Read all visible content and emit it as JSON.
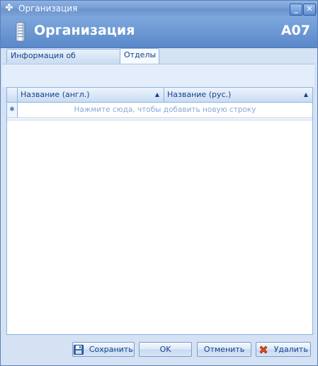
{
  "window": {
    "title": "Организация"
  },
  "header": {
    "heading": "Организация",
    "code": "A07"
  },
  "tabs": [
    {
      "label": "Информация об организации",
      "active": false
    },
    {
      "label": "Отделы",
      "active": true
    }
  ],
  "grid": {
    "columns": [
      "Название (англ.)",
      "Название (рус.)"
    ],
    "new_row_placeholder": "Нажмите сюда, чтобы добавить новую строку",
    "row_indicator": "✱"
  },
  "buttons": {
    "save": "Сохранить",
    "ok": "OK",
    "cancel": "Отменить",
    "delete": "Удалить"
  },
  "colors": {
    "accent": "#15428b",
    "header_bg": "#5a88c9",
    "panel_bg": "#d4e2f4"
  },
  "icons": [
    "app-icon",
    "building-icon",
    "minimize-icon",
    "close-icon",
    "sort-asc-icon",
    "save-icon",
    "delete-icon"
  ]
}
